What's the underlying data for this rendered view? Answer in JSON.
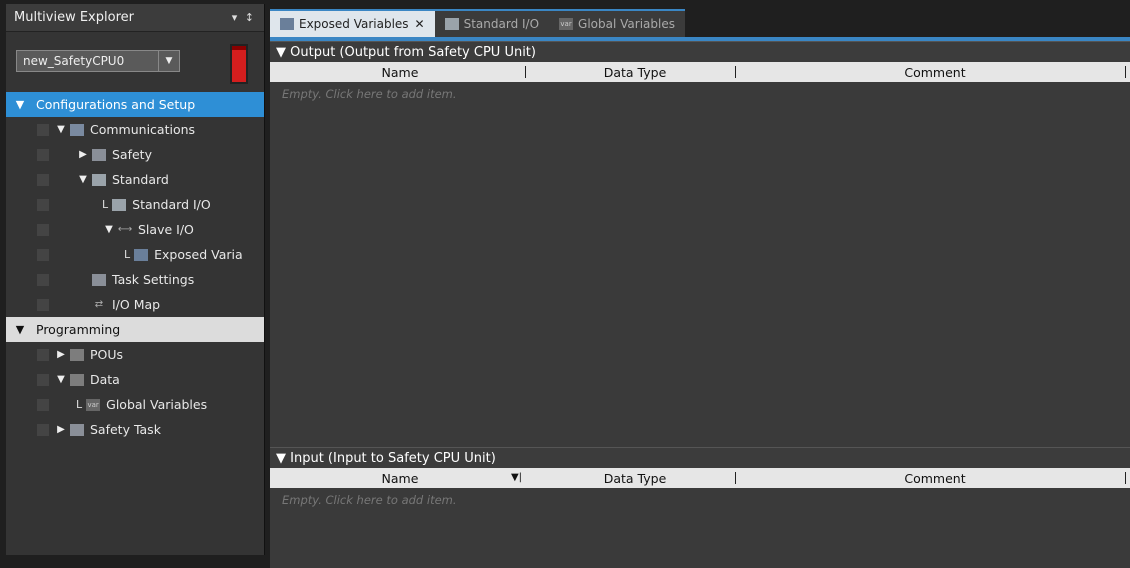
{
  "explorer": {
    "title": "Multiview Explorer",
    "pin": "▾ ↕",
    "device": "new_SafetyCPU0",
    "tree": [
      {
        "label": "Configurations and Setup",
        "level": 0,
        "type": "cat",
        "style": "blue"
      },
      {
        "label": "Communications",
        "level": 1,
        "expand": "▼",
        "icon": "comm"
      },
      {
        "label": "Safety",
        "level": 2,
        "expand": "▶",
        "icon": "safety"
      },
      {
        "label": "Standard",
        "level": 2,
        "expand": "▼",
        "icon": "std"
      },
      {
        "label": "Standard I/O",
        "level": 3,
        "leaf": true,
        "icon": "std"
      },
      {
        "label": "Slave I/O",
        "level": 3,
        "expand": "▼",
        "icon": "slave"
      },
      {
        "label": "Exposed Varia",
        "level": 4,
        "leaf": true,
        "icon": "expose"
      },
      {
        "label": "Task Settings",
        "level": 2,
        "icon": "task"
      },
      {
        "label": "I/O Map",
        "level": 2,
        "icon": "iomap"
      },
      {
        "label": "Programming",
        "level": 0,
        "type": "cat",
        "style": "gray"
      },
      {
        "label": "POUs",
        "level": 1,
        "expand": "▶",
        "icon": "pou"
      },
      {
        "label": "Data",
        "level": 1,
        "expand": "▼",
        "icon": "data"
      },
      {
        "label": "Global Variables",
        "level": 2,
        "leaf": true,
        "icon": "var"
      },
      {
        "label": "Safety Task",
        "level": 1,
        "expand": "▶",
        "icon": "task"
      }
    ]
  },
  "tabs": [
    {
      "label": "Exposed Variables",
      "active": true,
      "close": "✕"
    },
    {
      "label": "Standard I/O",
      "active": false
    },
    {
      "label": "Global Variables",
      "active": false
    }
  ],
  "output": {
    "title": "▼ Output (Output from Safety CPU Unit)",
    "columns": [
      "Name",
      "Data Type",
      "Comment"
    ],
    "empty": "Empty. Click here to add item."
  },
  "input": {
    "title": "▼ Input (Input to Safety CPU Unit)",
    "columns": [
      "Name",
      "Data Type",
      "Comment"
    ],
    "empty": "Empty. Click here to add item."
  }
}
